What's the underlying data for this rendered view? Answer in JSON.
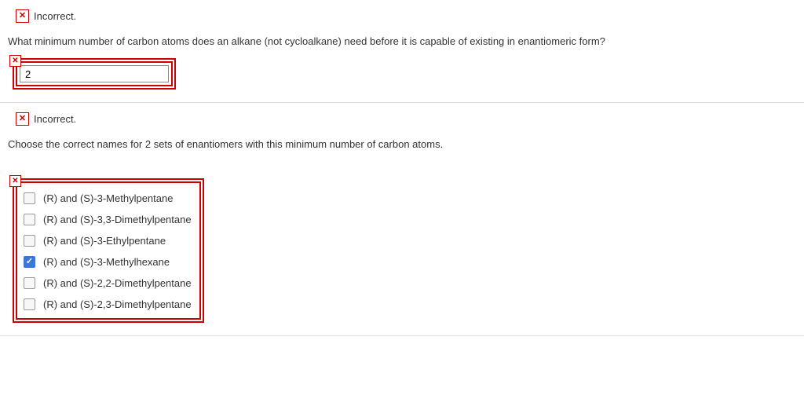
{
  "q1": {
    "status_label": "Incorrect.",
    "prompt": "What minimum number of carbon atoms does an alkane (not cycloalkane) need before it is capable of existing in enantiomeric form?",
    "answer_value": "2"
  },
  "q2": {
    "status_label": "Incorrect.",
    "prompt": "Choose the correct names for 2 sets of enantiomers with this minimum number of carbon atoms.",
    "options": [
      {
        "label": "(R) and (S)-3-Methylpentane",
        "checked": false
      },
      {
        "label": "(R) and (S)-3,3-Dimethylpentane",
        "checked": false
      },
      {
        "label": "(R) and (S)-3-Ethylpentane",
        "checked": false
      },
      {
        "label": "(R) and (S)-3-Methylhexane",
        "checked": true
      },
      {
        "label": "(R) and (S)-2,2-Dimethylpentane",
        "checked": false
      },
      {
        "label": "(R) and (S)-2,3-Dimethylpentane",
        "checked": false
      }
    ]
  }
}
